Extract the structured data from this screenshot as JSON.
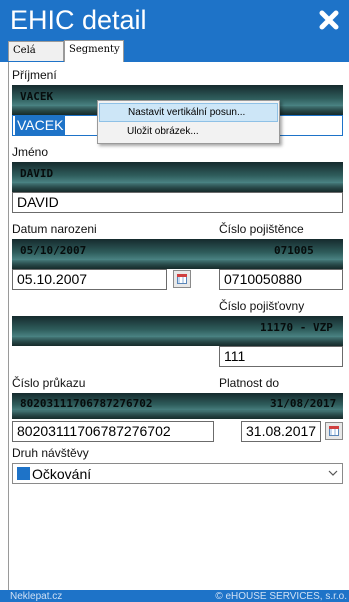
{
  "window": {
    "title": "EHIC detail",
    "close_icon": "close-x-icon"
  },
  "tabs": [
    {
      "label": "Celá karta",
      "active": false
    },
    {
      "label": "Segmenty",
      "active": true
    }
  ],
  "fields": {
    "prijmeni": {
      "label": "Příjmení",
      "strip_text": "VACEK",
      "value": "VACEK"
    },
    "jmeno": {
      "label": "Jméno",
      "strip_text": "DAVID",
      "value": "DAVID"
    },
    "datum_narozeni": {
      "label": "Datum narozeni",
      "strip_text": "05/10/2007",
      "value": "05.10.2007"
    },
    "cislo_pojistence": {
      "label": "Číslo pojištěnce",
      "strip_text": "071005",
      "value": "0710050880"
    },
    "cislo_pojistovny": {
      "label": "Číslo pojišťovny",
      "strip_text": "11170 - VZP",
      "value": "111"
    },
    "cislo_prukazu": {
      "label": "Číslo průkazu",
      "strip_text": "80203111706787276702",
      "value": "80203111706787276702"
    },
    "platnost_do": {
      "label": "Platnost do",
      "strip_text": "31/08/2017",
      "value": "31.08.2017"
    },
    "druh_navstevy": {
      "label": "Druh návštěvy",
      "value": "Očkování",
      "swatch_color": "#1e73c8"
    }
  },
  "context_menu": {
    "items": [
      {
        "label": "Nastavit vertikální posun...",
        "highlighted": true
      },
      {
        "label": "Uložit obrázek...",
        "highlighted": false
      }
    ]
  },
  "footer": {
    "left": "Neklepat.cz",
    "right": "© eHOUSE SERVICES, s.r.o."
  },
  "colors": {
    "accent": "#1e73c8",
    "menu_highlight": "#cde6f7"
  }
}
